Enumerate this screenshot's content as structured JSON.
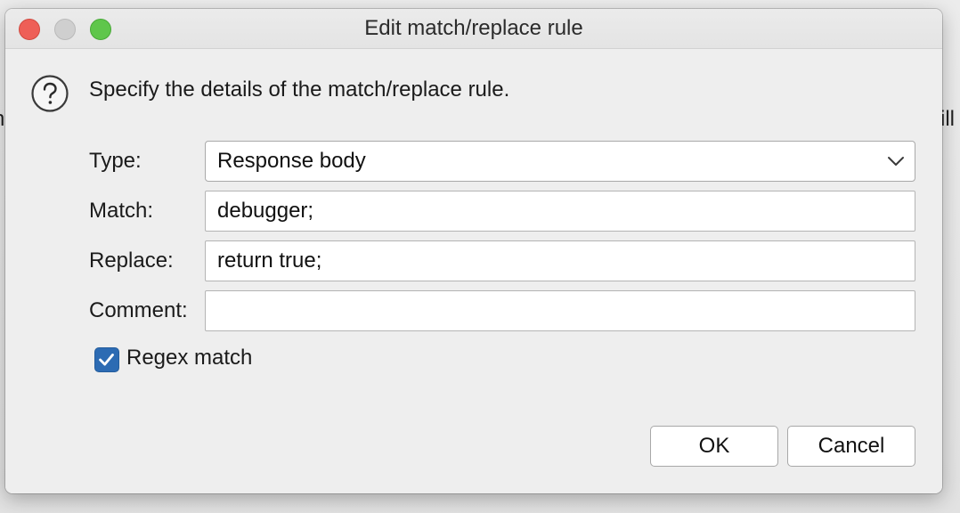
{
  "background": {
    "left_fragment": "h",
    "right_fragment": "ill"
  },
  "window": {
    "title": "Edit match/replace rule",
    "controls": [
      "close",
      "minimize",
      "zoom"
    ]
  },
  "dialog": {
    "icon": "question-circle-icon",
    "intro": "Specify the details of the match/replace rule.",
    "fields": {
      "type": {
        "label": "Type:",
        "value": "Response body"
      },
      "match": {
        "label": "Match:",
        "value": "debugger;"
      },
      "replace": {
        "label": "Replace:",
        "value": "return true;"
      },
      "comment": {
        "label": "Comment:",
        "value": ""
      }
    },
    "regex": {
      "label": "Regex match",
      "checked": true
    },
    "buttons": {
      "ok": "OK",
      "cancel": "Cancel"
    }
  },
  "colors": {
    "close": "#ee5f57",
    "minimize": "#cfcfcf",
    "zoom": "#5fc64b",
    "checkbox": "#2c6bb3"
  }
}
